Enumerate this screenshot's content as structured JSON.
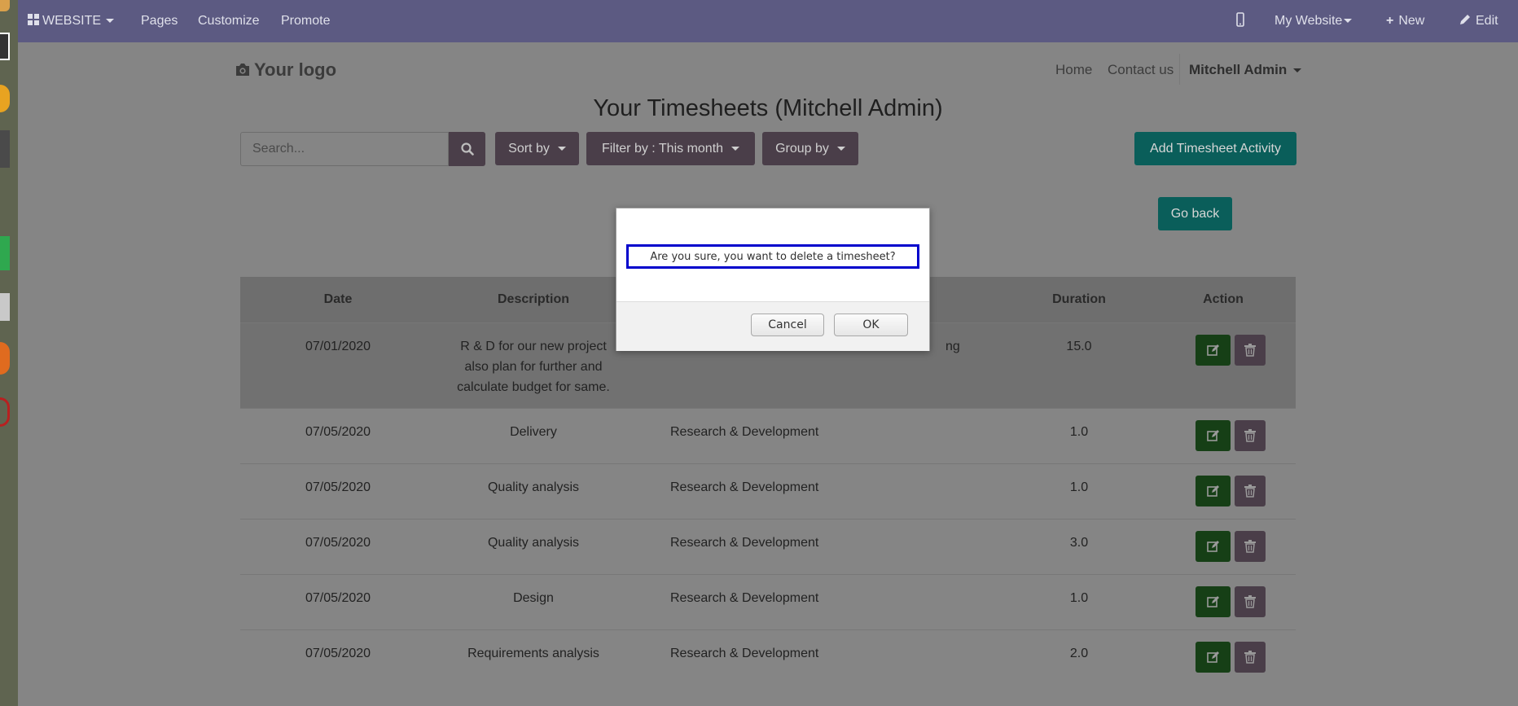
{
  "topbar": {
    "website_label": "WEBSITE",
    "pages": "Pages",
    "customize": "Customize",
    "promote": "Promote",
    "my_website": "My Website",
    "new": "New",
    "edit": "Edit"
  },
  "header": {
    "logo_text": "Your logo",
    "nav_home": "Home",
    "nav_contact": "Contact us",
    "user_name": "Mitchell Admin"
  },
  "page": {
    "title": "Your Timesheets (Mitchell Admin)",
    "search_placeholder": "Search...",
    "sort_by": "Sort by",
    "filter_by": "Filter by : This month",
    "group_by": "Group by",
    "add_activity": "Add Timesheet Activity",
    "go_back": "Go back"
  },
  "table": {
    "headers": {
      "date": "Date",
      "description": "Description",
      "duration": "Duration",
      "action": "Action"
    },
    "rows": [
      {
        "date": "07/01/2020",
        "desc_lines": [
          "R & D for our new project",
          "also plan for further and",
          "calculate budget for same."
        ],
        "project_visible": "ng",
        "duration": "15.0"
      },
      {
        "date": "07/05/2020",
        "description": "Delivery",
        "project": "Research & Development",
        "duration": "1.0"
      },
      {
        "date": "07/05/2020",
        "description": "Quality analysis",
        "project": "Research & Development",
        "duration": "1.0"
      },
      {
        "date": "07/05/2020",
        "description": "Quality analysis",
        "project": "Research & Development",
        "duration": "3.0"
      },
      {
        "date": "07/05/2020",
        "description": "Design",
        "project": "Research & Development",
        "duration": "1.0"
      },
      {
        "date": "07/05/2020",
        "description": "Requirements analysis",
        "project": "Research & Development",
        "duration": "2.0"
      }
    ]
  },
  "modal": {
    "message": "Are you sure, you want to delete a timesheet?",
    "cancel": "Cancel",
    "ok": "OK"
  },
  "colors": {
    "topbar": "#5c5a82",
    "primary": "#875a7b",
    "teal": "#00a09d",
    "edit_green": "#28a745",
    "highlight": "#0000cc"
  }
}
